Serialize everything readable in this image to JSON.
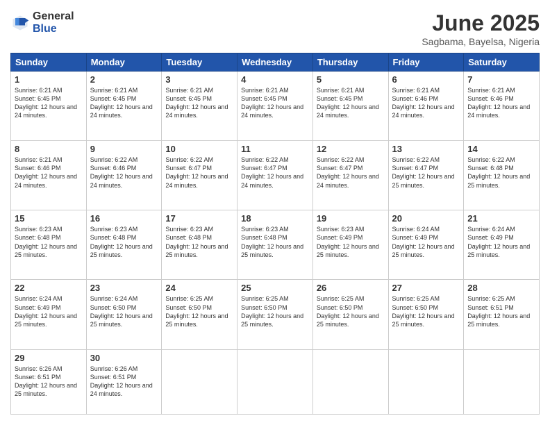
{
  "logo": {
    "general": "General",
    "blue": "Blue"
  },
  "header": {
    "month": "June 2025",
    "location": "Sagbama, Bayelsa, Nigeria"
  },
  "days_of_week": [
    "Sunday",
    "Monday",
    "Tuesday",
    "Wednesday",
    "Thursday",
    "Friday",
    "Saturday"
  ],
  "weeks": [
    [
      {
        "day": "1",
        "sunrise": "6:21 AM",
        "sunset": "6:45 PM",
        "daylight": "12 hours and 24 minutes."
      },
      {
        "day": "2",
        "sunrise": "6:21 AM",
        "sunset": "6:45 PM",
        "daylight": "12 hours and 24 minutes."
      },
      {
        "day": "3",
        "sunrise": "6:21 AM",
        "sunset": "6:45 PM",
        "daylight": "12 hours and 24 minutes."
      },
      {
        "day": "4",
        "sunrise": "6:21 AM",
        "sunset": "6:45 PM",
        "daylight": "12 hours and 24 minutes."
      },
      {
        "day": "5",
        "sunrise": "6:21 AM",
        "sunset": "6:45 PM",
        "daylight": "12 hours and 24 minutes."
      },
      {
        "day": "6",
        "sunrise": "6:21 AM",
        "sunset": "6:46 PM",
        "daylight": "12 hours and 24 minutes."
      },
      {
        "day": "7",
        "sunrise": "6:21 AM",
        "sunset": "6:46 PM",
        "daylight": "12 hours and 24 minutes."
      }
    ],
    [
      {
        "day": "8",
        "sunrise": "6:21 AM",
        "sunset": "6:46 PM",
        "daylight": "12 hours and 24 minutes."
      },
      {
        "day": "9",
        "sunrise": "6:22 AM",
        "sunset": "6:46 PM",
        "daylight": "12 hours and 24 minutes."
      },
      {
        "day": "10",
        "sunrise": "6:22 AM",
        "sunset": "6:47 PM",
        "daylight": "12 hours and 24 minutes."
      },
      {
        "day": "11",
        "sunrise": "6:22 AM",
        "sunset": "6:47 PM",
        "daylight": "12 hours and 24 minutes."
      },
      {
        "day": "12",
        "sunrise": "6:22 AM",
        "sunset": "6:47 PM",
        "daylight": "12 hours and 24 minutes."
      },
      {
        "day": "13",
        "sunrise": "6:22 AM",
        "sunset": "6:47 PM",
        "daylight": "12 hours and 25 minutes."
      },
      {
        "day": "14",
        "sunrise": "6:22 AM",
        "sunset": "6:48 PM",
        "daylight": "12 hours and 25 minutes."
      }
    ],
    [
      {
        "day": "15",
        "sunrise": "6:23 AM",
        "sunset": "6:48 PM",
        "daylight": "12 hours and 25 minutes."
      },
      {
        "day": "16",
        "sunrise": "6:23 AM",
        "sunset": "6:48 PM",
        "daylight": "12 hours and 25 minutes."
      },
      {
        "day": "17",
        "sunrise": "6:23 AM",
        "sunset": "6:48 PM",
        "daylight": "12 hours and 25 minutes."
      },
      {
        "day": "18",
        "sunrise": "6:23 AM",
        "sunset": "6:48 PM",
        "daylight": "12 hours and 25 minutes."
      },
      {
        "day": "19",
        "sunrise": "6:23 AM",
        "sunset": "6:49 PM",
        "daylight": "12 hours and 25 minutes."
      },
      {
        "day": "20",
        "sunrise": "6:24 AM",
        "sunset": "6:49 PM",
        "daylight": "12 hours and 25 minutes."
      },
      {
        "day": "21",
        "sunrise": "6:24 AM",
        "sunset": "6:49 PM",
        "daylight": "12 hours and 25 minutes."
      }
    ],
    [
      {
        "day": "22",
        "sunrise": "6:24 AM",
        "sunset": "6:49 PM",
        "daylight": "12 hours and 25 minutes."
      },
      {
        "day": "23",
        "sunrise": "6:24 AM",
        "sunset": "6:50 PM",
        "daylight": "12 hours and 25 minutes."
      },
      {
        "day": "24",
        "sunrise": "6:25 AM",
        "sunset": "6:50 PM",
        "daylight": "12 hours and 25 minutes."
      },
      {
        "day": "25",
        "sunrise": "6:25 AM",
        "sunset": "6:50 PM",
        "daylight": "12 hours and 25 minutes."
      },
      {
        "day": "26",
        "sunrise": "6:25 AM",
        "sunset": "6:50 PM",
        "daylight": "12 hours and 25 minutes."
      },
      {
        "day": "27",
        "sunrise": "6:25 AM",
        "sunset": "6:50 PM",
        "daylight": "12 hours and 25 minutes."
      },
      {
        "day": "28",
        "sunrise": "6:25 AM",
        "sunset": "6:51 PM",
        "daylight": "12 hours and 25 minutes."
      }
    ],
    [
      {
        "day": "29",
        "sunrise": "6:26 AM",
        "sunset": "6:51 PM",
        "daylight": "12 hours and 25 minutes."
      },
      {
        "day": "30",
        "sunrise": "6:26 AM",
        "sunset": "6:51 PM",
        "daylight": "12 hours and 24 minutes."
      },
      null,
      null,
      null,
      null,
      null
    ]
  ]
}
